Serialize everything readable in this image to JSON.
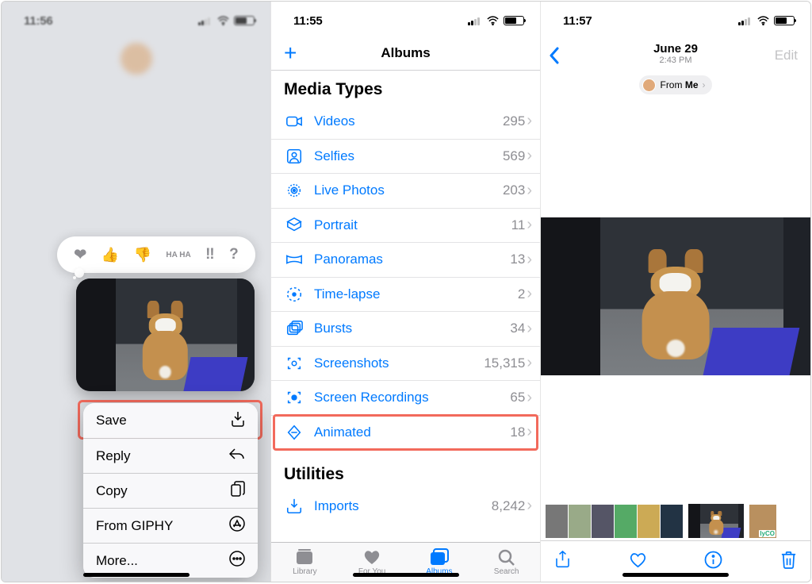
{
  "panel1": {
    "time": "11:56",
    "tapbacks": [
      "❤",
      "👍",
      "👎",
      "HA HA",
      "‼",
      "?"
    ],
    "tapback_names": [
      "heart-reaction",
      "thumbs-up-reaction",
      "thumbs-down-reaction",
      "haha-reaction",
      "exclaim-reaction",
      "question-reaction"
    ],
    "menu": [
      {
        "label": "Save",
        "icon": "download-icon",
        "highlighted": true
      },
      {
        "label": "Reply",
        "icon": "reply-icon"
      },
      {
        "label": "Copy",
        "icon": "copy-icon"
      },
      {
        "label": "From GIPHY",
        "icon": "appstore-icon"
      },
      {
        "label": "More...",
        "icon": "ellipsis-icon"
      }
    ]
  },
  "panel2": {
    "time": "11:55",
    "title": "Albums",
    "section1": "Media Types",
    "section2": "Utilities",
    "rows": [
      {
        "icon": "videos-icon",
        "label": "Videos",
        "count": "295"
      },
      {
        "icon": "selfies-icon",
        "label": "Selfies",
        "count": "569"
      },
      {
        "icon": "livephotos-icon",
        "label": "Live Photos",
        "count": "203"
      },
      {
        "icon": "portrait-icon",
        "label": "Portrait",
        "count": "11"
      },
      {
        "icon": "panoramas-icon",
        "label": "Panoramas",
        "count": "13"
      },
      {
        "icon": "timelapse-icon",
        "label": "Time-lapse",
        "count": "2"
      },
      {
        "icon": "bursts-icon",
        "label": "Bursts",
        "count": "34"
      },
      {
        "icon": "screenshots-icon",
        "label": "Screenshots",
        "count": "15,315"
      },
      {
        "icon": "screenrec-icon",
        "label": "Screen Recordings",
        "count": "65"
      },
      {
        "icon": "animated-icon",
        "label": "Animated",
        "count": "18",
        "highlighted": true
      }
    ],
    "util_rows": [
      {
        "icon": "imports-icon",
        "label": "Imports",
        "count": "8,242"
      }
    ],
    "tabs": [
      {
        "label": "Library",
        "icon": "library-tab-icon"
      },
      {
        "label": "For You",
        "icon": "foryou-tab-icon"
      },
      {
        "label": "Albums",
        "icon": "albums-tab-icon",
        "active": true
      },
      {
        "label": "Search",
        "icon": "search-tab-icon"
      }
    ]
  },
  "panel3": {
    "time": "11:57",
    "date": "June 29",
    "subtime": "2:43 PM",
    "edit": "Edit",
    "from_label_prefix": "From ",
    "from_label_strong": "Me",
    "thumb_badge": "lyCO"
  }
}
